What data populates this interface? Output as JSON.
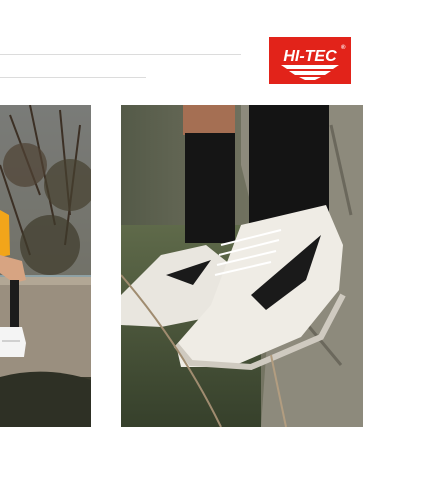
{
  "brand": {
    "logo_text": "HI-TEC",
    "logo_mark": "®",
    "logo_color": "#e2231a"
  },
  "placeholders": {
    "line_color": "#dcdcdc"
  },
  "photos": [
    {
      "subject": "person-sitting-on-stone-wall-photo",
      "position": "left"
    },
    {
      "subject": "white-hi-tec-sneaker-closeup-photo",
      "position": "right"
    }
  ]
}
